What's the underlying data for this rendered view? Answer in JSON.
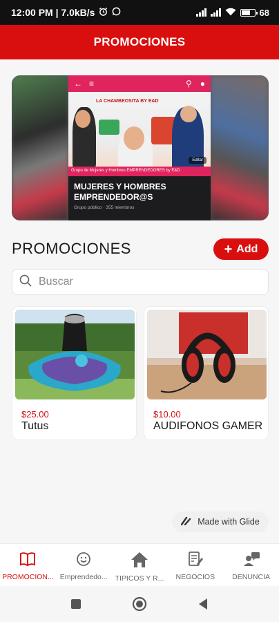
{
  "status_bar": {
    "time_speed": "12:00 PM | 7.0kB/s",
    "battery": "68"
  },
  "header": {
    "title": "PROMOCIONES"
  },
  "banner": {
    "top_title": "LA CHAMBEOSITA BY E&D",
    "caption": "Grupo de Mujeres y Hombres EMPRENDEDORES by E&D",
    "edit_label": "Editar",
    "group_name": "MUJERES Y HOMBRES EMPRENDEDOR@S",
    "group_meta": "Grupo público · 355 miembros"
  },
  "section": {
    "title": "PROMOCIONES",
    "add_label": "Add"
  },
  "search": {
    "placeholder": "Buscar"
  },
  "products": [
    {
      "price": "$25.00",
      "name": "Tutus"
    },
    {
      "price": "$10.00",
      "name": "AUDIFONOS GAMER"
    }
  ],
  "badge": {
    "label": "Made with Glide"
  },
  "bottom_nav": [
    {
      "label": "PROMOCION...",
      "icon": "book-icon",
      "active": true
    },
    {
      "label": "Emprendedo...",
      "icon": "smile-icon",
      "active": false
    },
    {
      "label": "TIPICOS Y R...",
      "icon": "home-icon",
      "active": false
    },
    {
      "label": "NEGOCIOS",
      "icon": "edit-document-icon",
      "active": false
    },
    {
      "label": "DENUNCIA",
      "icon": "person-chat-icon",
      "active": false
    }
  ],
  "colors": {
    "accent": "#d90f0f",
    "background": "#f6f6f7"
  }
}
